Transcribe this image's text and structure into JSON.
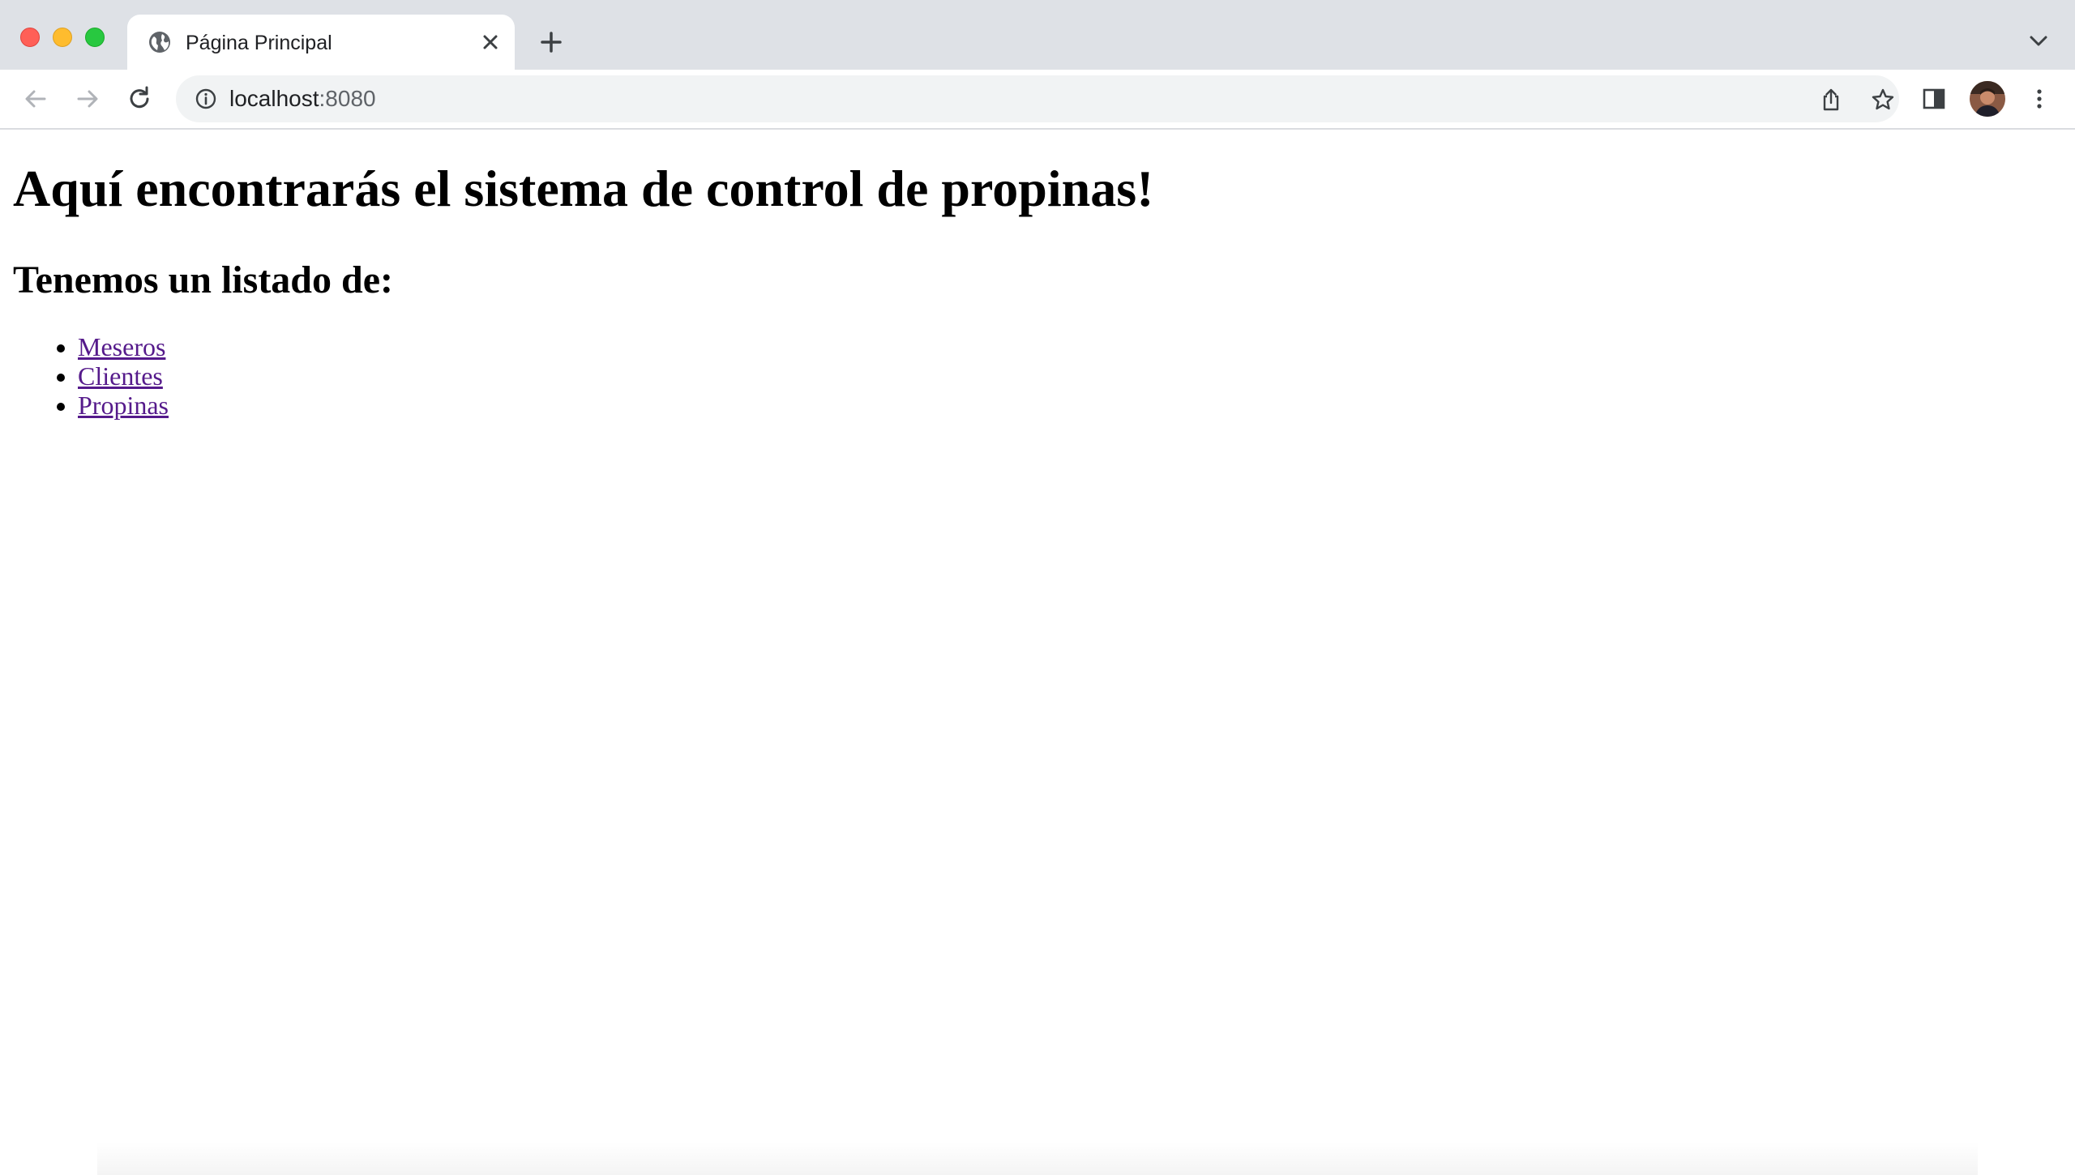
{
  "tab": {
    "title": "Página Principal"
  },
  "address_bar": {
    "host": "localhost",
    "port": ":8080"
  },
  "page": {
    "heading": "Aquí encontrarás el sistema de control de propinas!",
    "subheading": "Tenemos un listado de:",
    "links": [
      {
        "label": "Meseros"
      },
      {
        "label": "Clientes"
      },
      {
        "label": "Propinas"
      }
    ]
  },
  "colors": {
    "tabstrip_bg": "#dee1e6",
    "omnibox_bg": "#f1f3f4",
    "visited_link": "#551a8b"
  },
  "icons": {
    "window_controls": [
      "close-window-icon",
      "minimize-window-icon",
      "zoom-window-icon"
    ],
    "tab": [
      "globe-icon",
      "close-icon"
    ],
    "toolbar": [
      "back-arrow-icon",
      "forward-arrow-icon",
      "reload-icon",
      "info-icon",
      "share-icon",
      "star-icon",
      "side-panel-icon",
      "avatar",
      "more-vert-icon"
    ],
    "tabstrip": [
      "plus-icon",
      "chevron-down-icon"
    ]
  }
}
